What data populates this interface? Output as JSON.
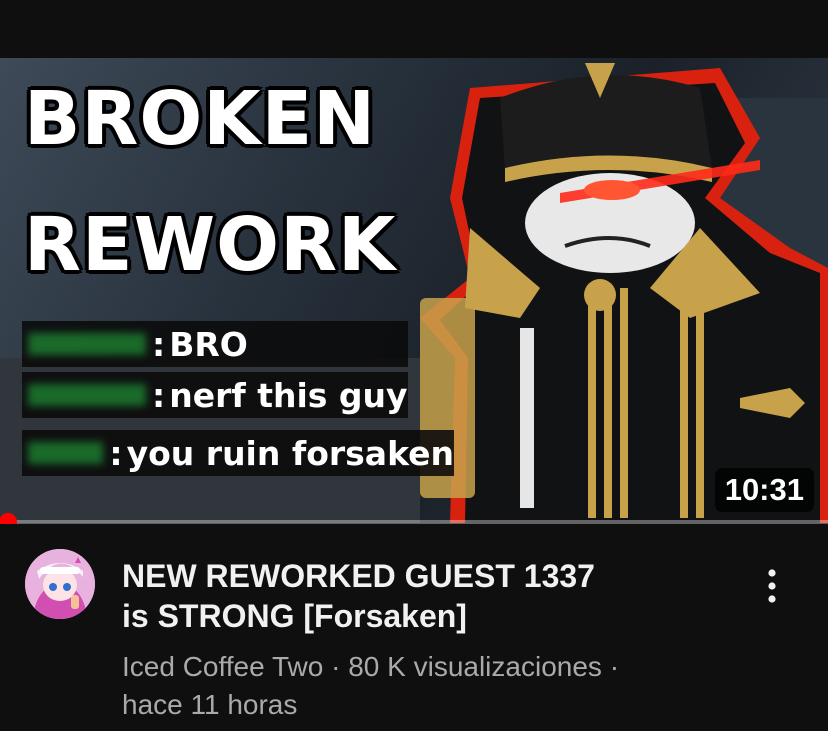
{
  "thumbnail": {
    "title_line1": "BROKEN",
    "title_line2": "REWORK",
    "chat": [
      {
        "sep": ":",
        "message": "BRO"
      },
      {
        "sep": ":",
        "message": "nerf this guy"
      },
      {
        "sep": ":",
        "message": "you ruin forsaken"
      }
    ],
    "duration": "10:31"
  },
  "progress": {
    "watched_fraction": 0.01,
    "color": "#ff0000"
  },
  "video": {
    "title_line1": "NEW REWORKED GUEST 1337",
    "title_line2": "is STRONG [Forsaken]",
    "channel": "Iced Coffee Two",
    "views": "80 K visualizaciones",
    "age": "hace 11 horas",
    "sep": "·",
    "avatar_icon": "anime-character-avatar-icon",
    "menu_icon": "more-vertical-icon"
  },
  "colors": {
    "background": "#0f0f0f",
    "title_text": "#f1f1f1",
    "meta_text": "#aaaaaa",
    "accent": "#ff0000"
  }
}
